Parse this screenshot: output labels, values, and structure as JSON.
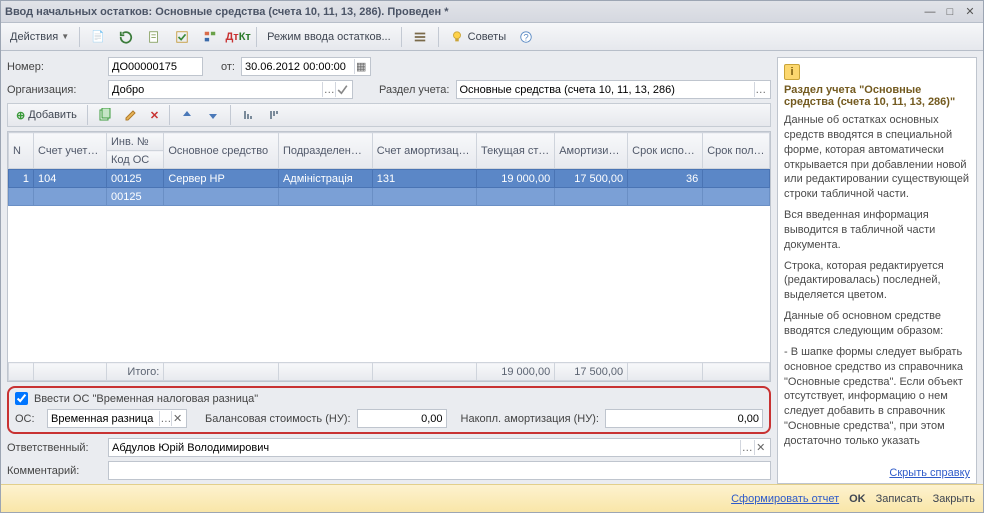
{
  "window": {
    "title": "Ввод начальных остатков: Основные средства (счета 10, 11, 13, 286). Проведен *"
  },
  "toolbar": {
    "actions": "Действия",
    "mode": "Режим ввода остатков...",
    "advice": "Советы"
  },
  "fields": {
    "number_label": "Номер:",
    "number_value": "ДО00000175",
    "from_label": "от:",
    "date_value": "30.06.2012 00:00:00",
    "org_label": "Организация:",
    "org_value": "Добро",
    "section_label": "Раздел учета:",
    "section_value": "Основные средства (счета 10, 11, 13, 286)"
  },
  "subtoolbar": {
    "add": "Добавить"
  },
  "grid": {
    "headers_top": [
      "N",
      "Счет учета (БУ)",
      "Инв. №",
      "Основное средство",
      "Подразделение организации",
      "Счет амортизации (БУ)",
      "Текущая стоимость …",
      "Амортизир…",
      "Срок использов…",
      "Срок полезн…"
    ],
    "headers_bot_2": "Код ОС",
    "row": {
      "n": "1",
      "acct": "104",
      "inv": "00125",
      "asset": "Сервер HP",
      "dept": "Адміністрація",
      "amort_acct": "131",
      "cost": "19 000,00",
      "amort": "17 500,00",
      "term": "36",
      "useful": ""
    },
    "row2_inv": "00125",
    "total_label": "Итого:",
    "total_cost": "19 000,00",
    "total_amort": "17 500,00"
  },
  "redbox": {
    "checkbox_label": "Ввести ОС \"Временная налоговая разница\"",
    "os_label": "ОС:",
    "os_value": "Временная разница",
    "balance_label": "Балансовая стоимость (НУ):",
    "balance_value": "0,00",
    "amort_label": "Накопл. амортизация (НУ):",
    "amort_value": "0,00"
  },
  "footer": {
    "resp_label": "Ответственный:",
    "resp_value": "Абдулов Юрій Володимирович",
    "comment_label": "Комментарий:",
    "comment_value": ""
  },
  "help": {
    "title": "Раздел учета \"Основные средства (счета 10, 11, 13, 286)\"",
    "p1": "Данные об остатках основных средств вводятся в специальной форме, которая автоматически открывается при добавлении новой или редактировании существующей строки табличной части.",
    "p2": "Вся введенная информация выводится в табличной части документа.",
    "p3": "Строка, которая редактируется (редактировалась) последней, выделяется цветом.",
    "p4": "Данные об основном средстве вводятся следующим образом:",
    "p5": "- В шапке формы следует выбрать основное средство из справочника \"Основные средства\". Если объект отсутствует, информацию о нем следует добавить в справочник \"Основные средства\", при этом достаточно только указать",
    "hide": "Скрыть справку"
  },
  "bottom": {
    "report": "Сформировать отчет",
    "ok": "OK",
    "save": "Записать",
    "close": "Закрыть"
  }
}
